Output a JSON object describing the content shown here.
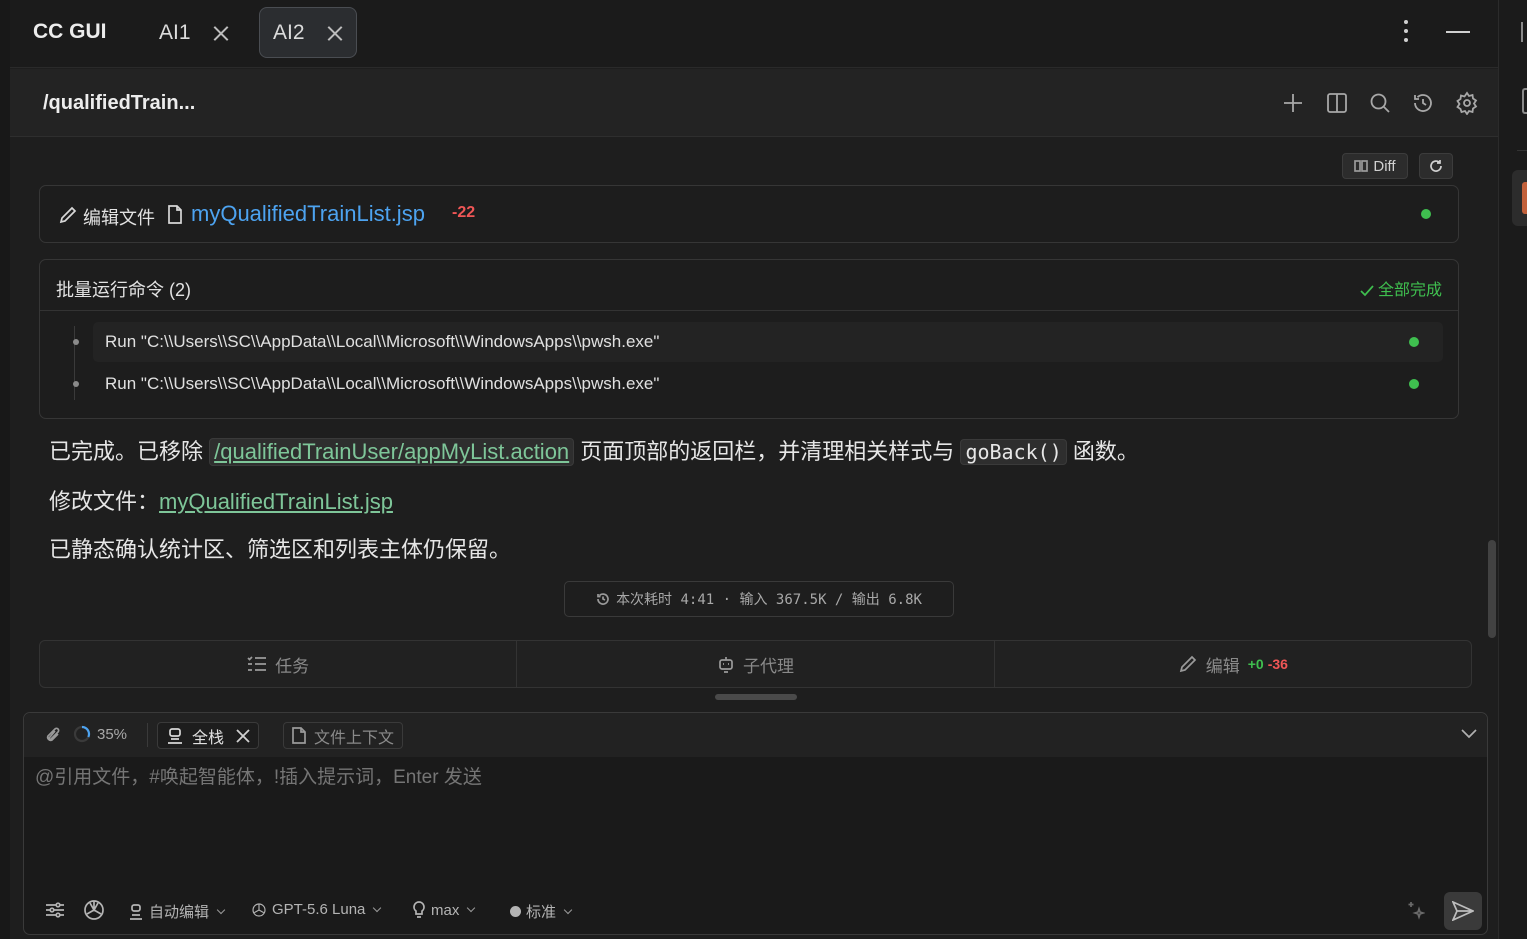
{
  "app": {
    "title": "CC GUI"
  },
  "tabs": [
    {
      "label": "AI1"
    },
    {
      "label": "AI2"
    }
  ],
  "header": {
    "path": "/qualifiedTrain..."
  },
  "diff": {
    "diff_label": "Diff"
  },
  "edit_card": {
    "label": "编辑文件",
    "file": "myQualifiedTrainList.jsp",
    "deleted": "-22",
    "status_color": "#3fbf4f"
  },
  "batch": {
    "title": "批量运行命令 (2)",
    "status": "全部完成",
    "commands": [
      {
        "text": "Run \"C:\\\\Users\\\\SC\\\\AppData\\\\Local\\\\Microsoft\\\\WindowsApps\\\\pwsh.exe\""
      },
      {
        "text": "Run \"C:\\\\Users\\\\SC\\\\AppData\\\\Local\\\\Microsoft\\\\WindowsApps\\\\pwsh.exe\""
      }
    ]
  },
  "message": {
    "line1_a": "已完成。已移除",
    "line1_path": "/qualifiedTrainUser/appMyList.action",
    "line1_b": "页面顶部的返回栏，并清理相关样式与",
    "line1_code": "goBack()",
    "line1_c": "函数。",
    "line2_label": "修改文件：",
    "line2_file": "myQualifiedTrainList.jsp",
    "line3": "已静态确认统计区、筛选区和列表主体仍保留。"
  },
  "stats": {
    "text": "本次耗时 4:41 · 输入 367.5K / 输出 6.8K"
  },
  "task_bar": {
    "tasks": "任务",
    "subagent": "子代理",
    "edit": "编辑",
    "added": "+0",
    "removed": "-36"
  },
  "input": {
    "progress": "35%",
    "mode_chip": "全栈",
    "context_chip": "文件上下文",
    "placeholder": "@引用文件，#唤起智能体，!插入提示词，Enter 发送"
  },
  "bottom_toolbar": {
    "auto_edit": "自动编辑",
    "model": "GPT-5.6 Luna",
    "effort": "max",
    "style": "标准"
  },
  "colors": {
    "accent_green": "#3fbf4f",
    "link_blue": "#4da3f0",
    "delete_red": "#f05656",
    "link_green": "#7ec699"
  }
}
